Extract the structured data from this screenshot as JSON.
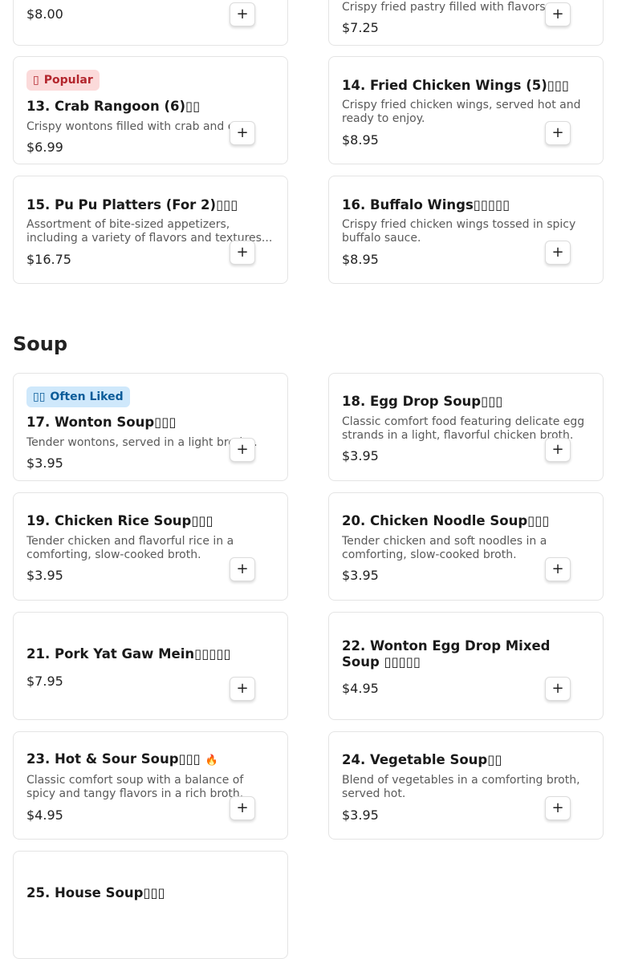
{
  "sections": {
    "soup_title": "Soup"
  },
  "cards": {
    "c11": {
      "description": "",
      "price": "$8.00",
      "add_label": "+"
    },
    "c12": {
      "description": "Crispy fried pastry filled with flavors,...",
      "price": "$7.25",
      "add_label": "+"
    },
    "c13": {
      "badge": "Popular",
      "badge_icon": "▯",
      "title": "13. Crab Rangoon (6)▯▯",
      "description": "Crispy wontons filled with crab and cre...",
      "price": "$6.99",
      "add_label": "+"
    },
    "c14": {
      "title": "14. Fried Chicken Wings (5)▯▯▯",
      "description": "Crispy fried chicken wings, served hot and ready to enjoy.",
      "price": "$8.95",
      "add_label": "+"
    },
    "c15": {
      "title": "15. Pu Pu Platters (For 2)▯▯▯",
      "description": "Assortment of bite-sized appetizers, including a variety of flavors and textures...",
      "price": "$16.75",
      "add_label": "+"
    },
    "c16": {
      "title": "16. Buffalo Wings▯▯▯▯▯",
      "description": "Crispy fried chicken wings tossed in spicy buffalo sauce.",
      "price": "$8.95",
      "add_label": "+"
    },
    "c17": {
      "badge": "Often Liked",
      "badge_icon": "▯▯",
      "title": "17. Wonton Soup▯▯▯",
      "description": "Tender wontons, served in a light broth...",
      "price": "$3.95",
      "add_label": "+"
    },
    "c18": {
      "title": "18. Egg Drop Soup▯▯▯",
      "description": "Classic comfort food featuring delicate egg strands in a light, flavorful chicken broth.",
      "price": "$3.95",
      "add_label": "+"
    },
    "c19": {
      "title": "19. Chicken Rice Soup▯▯▯",
      "description": "Tender chicken and flavorful rice in a comforting, slow-cooked broth.",
      "price": "$3.95",
      "add_label": "+"
    },
    "c20": {
      "title": "20. Chicken Noodle Soup▯▯▯",
      "description": "Tender chicken and soft noodles in a comforting, slow-cooked broth.",
      "price": "$3.95",
      "add_label": "+"
    },
    "c21": {
      "title": "21. Pork Yat Gaw Mein▯▯▯▯▯",
      "price": "$7.95",
      "add_label": "+"
    },
    "c22": {
      "title": "22. Wonton Egg Drop Mixed Soup ▯▯▯▯▯",
      "price": "$4.95",
      "add_label": "+"
    },
    "c23": {
      "title": "23. Hot & Sour Soup▯▯▯",
      "flame_icon": "spicy-flame-icon",
      "description": "Classic comfort soup with a balance of spicy and tangy flavors in a rich broth.",
      "price": "$4.95",
      "add_label": "+"
    },
    "c24": {
      "title": "24. Vegetable Soup▯▯",
      "description": "Blend of vegetables in a comforting broth, served hot.",
      "price": "$3.95",
      "add_label": "+"
    },
    "c25": {
      "title": "25. House Soup▯▯▯"
    }
  },
  "colors": {
    "popular_badge_bg": "#fbdada",
    "popular_badge_text": "#b3262d",
    "liked_badge_bg": "#cfe8fb",
    "liked_badge_text": "#0b5c99",
    "flame": "#d9482b"
  }
}
